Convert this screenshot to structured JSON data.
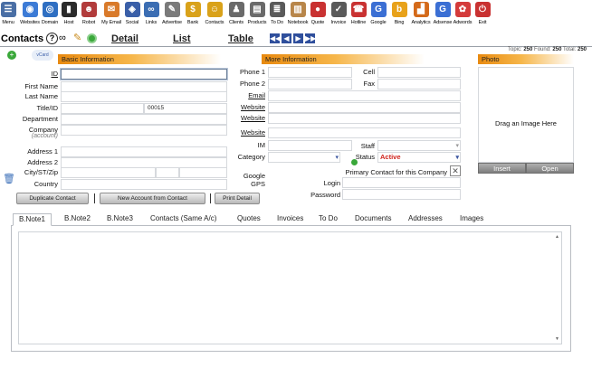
{
  "toolbar": [
    {
      "label": "Menu",
      "icon": "menu-icon",
      "glyph": "☰",
      "color": "#4a6fa5"
    },
    {
      "label": "Websites",
      "icon": "websites-icon",
      "glyph": "◉",
      "color": "#3c7bd6"
    },
    {
      "label": "Domain",
      "icon": "domain-icon",
      "glyph": "◎",
      "color": "#2f6fc2"
    },
    {
      "label": "Host",
      "icon": "host-icon",
      "glyph": "▮",
      "color": "#2b2b2b"
    },
    {
      "label": "Robot",
      "icon": "robot-icon",
      "glyph": "☻",
      "color": "#b23b3b"
    },
    {
      "label": "My Email",
      "icon": "email-icon",
      "glyph": "✉",
      "color": "#d97a2a"
    },
    {
      "label": "Social",
      "icon": "social-icon",
      "glyph": "◈",
      "color": "#3a5fa8"
    },
    {
      "label": "Links",
      "icon": "links-icon",
      "glyph": "∞",
      "color": "#3b6db3"
    },
    {
      "label": "Advertise",
      "icon": "advertise-icon",
      "glyph": "✎",
      "color": "#7a7a7a"
    },
    {
      "label": "Bank",
      "icon": "bank-icon",
      "glyph": "$",
      "color": "#d9a21a"
    },
    {
      "label": "Contacts",
      "icon": "contacts-icon",
      "glyph": "☺",
      "color": "#d9a21a"
    },
    {
      "label": "Clients",
      "icon": "clients-icon",
      "glyph": "♟",
      "color": "#6a6a6a"
    },
    {
      "label": "Products",
      "icon": "products-icon",
      "glyph": "▤",
      "color": "#6a6a6a"
    },
    {
      "label": "To Do",
      "icon": "todo-icon",
      "glyph": "≣",
      "color": "#5a5a5a"
    },
    {
      "label": "Notebook",
      "icon": "notebook-icon",
      "glyph": "▥",
      "color": "#b8864a"
    },
    {
      "label": "Quote",
      "icon": "quote-icon",
      "glyph": "●",
      "color": "#c93232"
    },
    {
      "label": "Invoice",
      "icon": "invoice-icon",
      "glyph": "✓",
      "color": "#5a5a5a"
    },
    {
      "label": "Hotline",
      "icon": "hotline-icon",
      "glyph": "☎",
      "color": "#c93232"
    },
    {
      "label": "Google",
      "icon": "google-icon",
      "glyph": "G",
      "color": "#3b6fd4"
    },
    {
      "label": "Bing",
      "icon": "bing-icon",
      "glyph": "b",
      "color": "#e8a21a"
    },
    {
      "label": "Analytics",
      "icon": "analytics-icon",
      "glyph": "▟",
      "color": "#d46a1a"
    },
    {
      "label": "Adsense",
      "icon": "adsense-icon",
      "glyph": "G",
      "color": "#3b6fd4"
    },
    {
      "label": "Adwords",
      "icon": "adwords-icon",
      "glyph": "✿",
      "color": "#d43b3b"
    },
    {
      "label": "Exit",
      "icon": "exit-icon",
      "glyph": "⏻",
      "color": "#c93232"
    }
  ],
  "header": {
    "title": "Contacts",
    "help_glyph": "?",
    "detail_link": "Detail",
    "list_link": "List",
    "table_link": "Table",
    "nav": [
      "◀◀",
      "◀",
      "▶",
      "▶▶"
    ]
  },
  "counts": {
    "topic_label": "Topic:",
    "topic": "250",
    "found_label": "Found:",
    "found": "250",
    "total_label": "Total:",
    "total": "250"
  },
  "basic": {
    "header": "Basic Information",
    "labels": {
      "id": "ID",
      "first_name": "First Name",
      "last_name": "Last Name",
      "title_id": "Title/ID",
      "department": "Department",
      "company": "Company",
      "company_sub": "(account)",
      "address1": "Address 1",
      "address2": "Address 2",
      "city_st_zip": "City/ST/Zip",
      "country": "Country"
    },
    "values": {
      "id": "",
      "title_id_right": "00015"
    }
  },
  "more": {
    "header": "More Information",
    "labels": {
      "phone1": "Phone 1",
      "phone2": "Phone 2",
      "email": "Email",
      "website1": "Website",
      "website2": "Website",
      "website3": "Website",
      "im": "IM",
      "category": "Category",
      "google_gps_1": "Google",
      "google_gps_2": "GPS",
      "login": "Login",
      "password": "Password",
      "cell": "Cell",
      "fax": "Fax",
      "staff": "Staff",
      "status": "Status",
      "primary_contact": "Primary Contact for this Company"
    },
    "values": {
      "status": "Active"
    }
  },
  "photo": {
    "header": "Photo",
    "placeholder": "Drag an Image Here",
    "insert": "Insert",
    "open": "Open"
  },
  "actions": {
    "duplicate": "Duplicate Contact",
    "new_account": "New Account from Contact",
    "print": "Print Detail"
  },
  "tabs": [
    "B.Note1",
    "B.Note2",
    "B.Note3",
    "Contacts (Same A/c)",
    "Quotes",
    "Invoices",
    "To Do",
    "Documents",
    "Addresses",
    "Images"
  ],
  "colors": {
    "accent_orange": "#e88a10",
    "status_red": "#d0241c",
    "nav_blue": "#2f4f9c"
  }
}
